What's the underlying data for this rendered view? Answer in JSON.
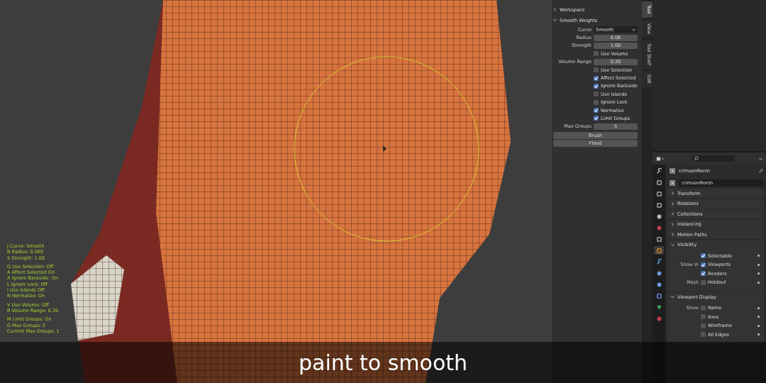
{
  "viewport": {
    "hud_groups": [
      [
        "J  Curve: Smooth",
        "B  Radius: 0.065",
        "S  Strength: 1.00"
      ],
      [
        "Q  Use Selection: Off",
        "A  Affect Selected On",
        "X  Ignore Backside: On",
        "L  Ignore Lock: Off",
        "I  Use Islands Off",
        "N  Normalize: On"
      ],
      [
        "V  Use Volume: Off",
        "R  Volume Range: 0.20"
      ],
      [
        "M  Limit Groups: On",
        "G  Max Groups: 5",
        "Current Max Groups: 1"
      ]
    ]
  },
  "tool_panel": {
    "sections": [
      {
        "label": "Workspace",
        "expanded": false
      },
      {
        "label": "Smooth Weights",
        "expanded": true,
        "rows": [
          {
            "kind": "dropdown",
            "label": "Curve",
            "value": "Smooth"
          },
          {
            "kind": "number",
            "label": "Radius",
            "value": "0.06"
          },
          {
            "kind": "number",
            "label": "Strength",
            "value": "1.00"
          },
          {
            "kind": "checkbox",
            "label": "Use Volume",
            "checked": false
          },
          {
            "kind": "number",
            "label": "Volume Range",
            "value": "0.20"
          },
          {
            "kind": "checkbox",
            "label": "Use Selection",
            "checked": false
          },
          {
            "kind": "checkbox",
            "label": "Affect Selected",
            "checked": true
          },
          {
            "kind": "checkbox",
            "label": "Ignore Backside",
            "checked": true
          },
          {
            "kind": "checkbox",
            "label": "Use Islands",
            "checked": false
          },
          {
            "kind": "checkbox",
            "label": "Ignore Lock",
            "checked": false
          },
          {
            "kind": "checkbox",
            "label": "Normalize",
            "checked": true
          },
          {
            "kind": "checkbox",
            "label": "Limit Groups",
            "checked": true
          },
          {
            "kind": "number",
            "label": "Max Groups",
            "value": "5"
          },
          {
            "kind": "button",
            "label": "Brush"
          },
          {
            "kind": "button",
            "label": "Flood"
          }
        ]
      }
    ]
  },
  "side_tabs": [
    {
      "label": "Tool",
      "selected": true
    },
    {
      "label": "View",
      "selected": false
    },
    {
      "label": "Tool Shelf",
      "selected": false
    },
    {
      "label": "Edit",
      "selected": false
    }
  ],
  "properties": {
    "object_name": "crimsonRonin",
    "data_name": "crimsonRonin",
    "tabs": [
      {
        "selected": false
      },
      {
        "selected": false
      },
      {
        "selected": false
      },
      {
        "selected": false
      },
      {
        "selected": false
      },
      {
        "selected": false
      },
      {
        "selected": false
      },
      {
        "selected": true
      },
      {
        "selected": false
      },
      {
        "selected": false
      },
      {
        "selected": false
      },
      {
        "selected": false
      },
      {
        "selected": false
      },
      {
        "selected": false
      }
    ],
    "panels": [
      {
        "label": "Transform",
        "expanded": false
      },
      {
        "label": "Relations",
        "expanded": false
      },
      {
        "label": "Collections",
        "expanded": false
      },
      {
        "label": "Instancing",
        "expanded": false
      },
      {
        "label": "Motion Paths",
        "expanded": false
      },
      {
        "label": "Visibility",
        "expanded": true,
        "rows": [
          {
            "prefix": "",
            "label": "Selectable",
            "checked": true
          },
          {
            "prefix": "Show In",
            "label": "Viewports",
            "checked": true
          },
          {
            "prefix": "",
            "label": "Renders",
            "checked": true
          },
          {
            "prefix": "Mask",
            "label": "Holdout",
            "checked": false
          }
        ]
      },
      {
        "label": "Viewport Display",
        "expanded": true,
        "rows": [
          {
            "prefix": "Show",
            "label": "Name",
            "checked": false
          },
          {
            "prefix": "",
            "label": "Axes",
            "checked": false
          },
          {
            "prefix": "",
            "label": "Wireframe",
            "checked": false
          },
          {
            "prefix": "",
            "label": "All Edges",
            "checked": false
          }
        ]
      }
    ]
  },
  "caption": "paint to smooth"
}
